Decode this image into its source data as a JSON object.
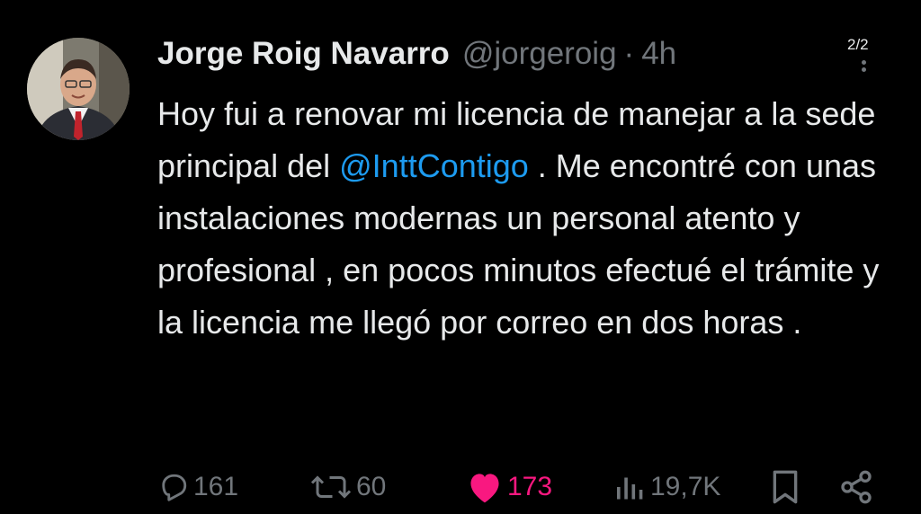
{
  "tweet": {
    "author_name": "Jorge Roig Navarro",
    "author_handle": "@jorgeroig",
    "separator": "·",
    "time": "4h",
    "pager": "2/2",
    "text_part1": "Hoy fui a renovar mi licencia de manejar a la sede principal del ",
    "mention": "@InttContigo",
    "text_part2": " . Me encontré con unas instalaciones modernas un personal atento y profesional , en pocos minutos efectué el trámite y la licencia me llegó por correo en dos horas ."
  },
  "actions": {
    "replies": "161",
    "reposts": "60",
    "likes": "173",
    "views": "19,7K"
  },
  "icons": {
    "reply": "reply-icon",
    "repost": "repost-icon",
    "like": "heart-icon",
    "views": "views-icon",
    "bookmark": "bookmark-icon",
    "share": "share-icon",
    "more": "more-icon"
  },
  "colors": {
    "background": "#000000",
    "text": "#e7e9ea",
    "muted": "#71767b",
    "link": "#1d9bf0",
    "like": "#f91880"
  }
}
